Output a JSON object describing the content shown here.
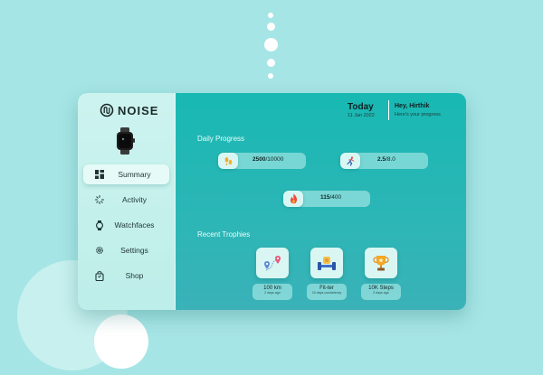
{
  "brand": {
    "name": "NOISE"
  },
  "sidebar": {
    "items": [
      {
        "label": "Summary",
        "icon": "grid-icon",
        "active": true
      },
      {
        "label": "Activity",
        "icon": "activity-icon",
        "active": false
      },
      {
        "label": "Watchfaces",
        "icon": "watchface-icon",
        "active": false
      },
      {
        "label": "Settings",
        "icon": "gear-icon",
        "active": false
      },
      {
        "label": "Shop",
        "icon": "shopping-bag-icon",
        "active": false
      }
    ]
  },
  "header": {
    "today_label": "Today",
    "date": "11 Jan 2022",
    "greeting": "Hey, Hirthik",
    "subtitle": "Here's your progress"
  },
  "daily_progress": {
    "title": "Daily Progress",
    "stats": [
      {
        "name": "steps",
        "icon": "footsteps-icon",
        "value": "2500",
        "goal": "/10000"
      },
      {
        "name": "distance",
        "icon": "runner-icon",
        "value": "2.5",
        "goal": "/8.0"
      },
      {
        "name": "calories",
        "icon": "flame-icon",
        "value": "115",
        "goal": "/400"
      }
    ]
  },
  "recent_trophies": {
    "title": "Recent Trophies",
    "items": [
      {
        "title": "100 km",
        "subtitle": "2 days ago",
        "icon": "map-pins-icon"
      },
      {
        "title": "Fit-ter",
        "subtitle": "10 days consistency",
        "icon": "dumbbell-icon"
      },
      {
        "title": "10K Steps",
        "subtitle": "3 days ago",
        "icon": "trophy-icon"
      }
    ]
  },
  "colors": {
    "background": "#a6e5e5",
    "panel": "#18b8b3",
    "sidebar": "#cdf3ef",
    "accent": "#f39c12"
  }
}
